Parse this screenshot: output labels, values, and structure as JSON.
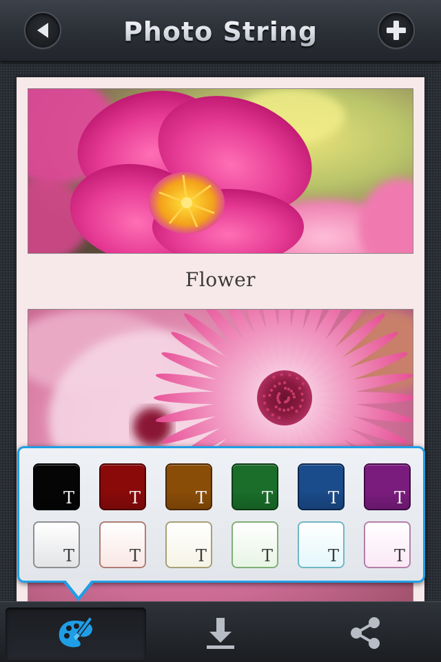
{
  "navbar": {
    "title": "Photo String",
    "back_icon": "back-arrow-icon",
    "add_icon": "plus-icon"
  },
  "content": {
    "photos": [
      {
        "subject": "pink portulaca flower",
        "caption": "Flower"
      },
      {
        "subject": "pink daisy-like flower",
        "caption": ""
      }
    ]
  },
  "color_picker": {
    "accent": "#1f9ee6",
    "glyph": "T",
    "dark_swatches": [
      {
        "name": "black",
        "fill": "#050505",
        "border": "#000000",
        "text": "#f2f2f2"
      },
      {
        "name": "dark-red",
        "fill": "#8a0a0a",
        "border": "#4a0000",
        "text": "#f2f2f2"
      },
      {
        "name": "brown",
        "fill": "#8a4d08",
        "border": "#4a2600",
        "text": "#f2f2f2"
      },
      {
        "name": "green",
        "fill": "#1a6e2a",
        "border": "#0b3a14",
        "text": "#f2f2f2"
      },
      {
        "name": "blue",
        "fill": "#1a4b8a",
        "border": "#0b264a",
        "text": "#f2f2f2"
      },
      {
        "name": "purple",
        "fill": "#7a1c7e",
        "border": "#3e0a42",
        "text": "#f2f2f2"
      }
    ],
    "light_swatches": [
      {
        "name": "light-gray",
        "fill": "#e3e4e6",
        "border": "#8e8e8e",
        "text": "#3a3a3a"
      },
      {
        "name": "light-pink",
        "fill": "#f9e7e4",
        "border": "#b07c74",
        "text": "#3a3a3a"
      },
      {
        "name": "light-cream",
        "fill": "#f6f4e6",
        "border": "#a79f74",
        "text": "#3a3a3a"
      },
      {
        "name": "light-green",
        "fill": "#e7f5e4",
        "border": "#7fae78",
        "text": "#3a3a3a"
      },
      {
        "name": "light-cyan",
        "fill": "#e4f7fb",
        "border": "#6fb6c4",
        "text": "#3a3a3a"
      },
      {
        "name": "light-lavender",
        "fill": "#fbe8f6",
        "border": "#b47eaa",
        "text": "#3a3a3a"
      }
    ]
  },
  "tabbar": {
    "items": [
      {
        "icon": "paint-palette-icon",
        "active": true,
        "color": "#1f9ee6"
      },
      {
        "icon": "download-icon",
        "active": false,
        "color": "#b8bcc4"
      },
      {
        "icon": "share-icon",
        "active": false,
        "color": "#b8bcc4"
      }
    ]
  }
}
